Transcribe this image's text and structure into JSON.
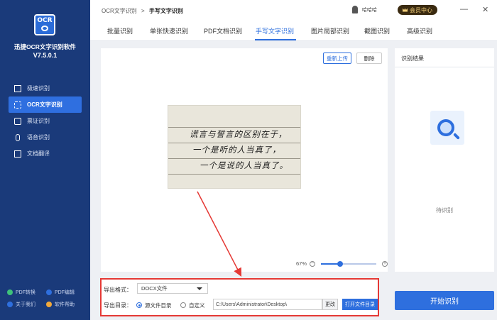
{
  "app": {
    "logo_text": "OCR",
    "name": "迅捷OCR文字识别软件",
    "version": "V7.5.0.1"
  },
  "sidebar": {
    "items": [
      {
        "label": "极速识别",
        "icon": "lightning-edit-icon",
        "active": false
      },
      {
        "label": "OCR文字识别",
        "icon": "ocr-scan-icon",
        "active": true
      },
      {
        "label": "票证识别",
        "icon": "ticket-icon",
        "active": false
      },
      {
        "label": "语音识别",
        "icon": "microphone-icon",
        "active": false
      },
      {
        "label": "文档翻译",
        "icon": "translate-doc-icon",
        "active": false
      }
    ],
    "bottom_links": [
      {
        "label": "PDF转换",
        "icon": "pdf-convert-icon",
        "color": "#3ec27a"
      },
      {
        "label": "PDF编辑",
        "icon": "pdf-edit-icon",
        "color": "#2e6fde"
      },
      {
        "label": "关于我们",
        "icon": "about-icon",
        "color": "#2e6fde"
      },
      {
        "label": "软件帮助",
        "icon": "help-icon",
        "color": "#f2a93b"
      }
    ]
  },
  "header": {
    "breadcrumb_root": "OCR文字识别",
    "breadcrumb_sep": ">",
    "breadcrumb_current": "手写文字识别",
    "username": "哈哈哈",
    "vip_label": "会员中心",
    "minimize": "—",
    "close": "✕"
  },
  "tabs": [
    {
      "label": "批量识别",
      "active": false
    },
    {
      "label": "单张快速识别",
      "active": false
    },
    {
      "label": "PDF文档识别",
      "active": false
    },
    {
      "label": "手写文字识别",
      "active": true
    },
    {
      "label": "图片局部识别",
      "active": false
    },
    {
      "label": "截图识别",
      "active": false
    },
    {
      "label": "高级识别",
      "active": false
    }
  ],
  "work": {
    "reupload_label": "重新上传",
    "delete_label": "删除",
    "handwriting_lines": [
      "谎言与誓言的区别在于，",
      "一个是听的人当真了，",
      "一个是说的人当真了。"
    ],
    "zoom_percent": "67%",
    "zoom_level": 0.35,
    "zoom_minus": "−",
    "zoom_plus": "+"
  },
  "result": {
    "title": "识别结果",
    "waiting": "待识别"
  },
  "export": {
    "format_label": "导出格式：",
    "format_value": "DOCX文件",
    "dir_label": "导出目录：",
    "radio_source_label": "源文件目录",
    "radio_custom_label": "自定义",
    "path_value": "C:\\Users\\Administrator\\Desktop\\",
    "change_label": "更改",
    "open_dir_label": "打开文件目录"
  },
  "start_label": "开始识别",
  "colors": {
    "sidebar_bg": "#1a3a7a",
    "accent": "#2e6fde",
    "highlight_border": "#e53935"
  }
}
